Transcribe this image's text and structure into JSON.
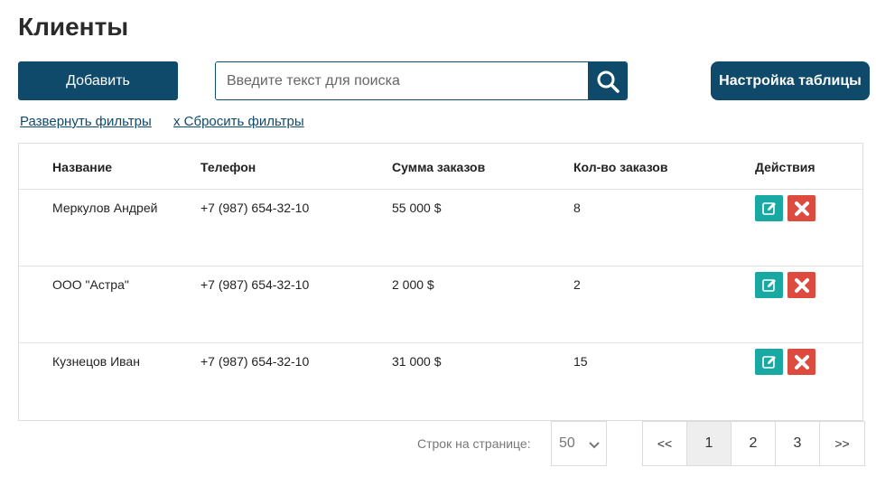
{
  "page": {
    "title": "Клиенты"
  },
  "toolbar": {
    "add_label": "Добавить",
    "search_placeholder": "Введите текст для поиска",
    "settings_label": "Настройка таблицы"
  },
  "filters": {
    "expand_label": "Развернуть фильтры",
    "reset_label": "x Сбросить фильтры"
  },
  "table": {
    "headers": [
      "Название",
      "Телефон",
      "Сумма заказов",
      "Кол-во заказов",
      "Действия"
    ],
    "rows": [
      {
        "name": "Меркулов Андрей",
        "phone": "+7 (987) 654-32-10",
        "sum": "55 000 $",
        "count": "8"
      },
      {
        "name": "ООО \"Астра\"",
        "phone": "+7 (987) 654-32-10",
        "sum": "2 000 $",
        "count": "2"
      },
      {
        "name": "Кузнецов Иван",
        "phone": "+7 (987) 654-32-10",
        "sum": "31 000 $",
        "count": "15"
      }
    ]
  },
  "pagination": {
    "rows_label": "Строк на странице:",
    "rows_per_page": "50",
    "prev": "<<",
    "pages": [
      "1",
      "2",
      "3"
    ],
    "next": ">>",
    "current": "1"
  },
  "colors": {
    "primary": "#0f4a6b",
    "edit": "#1aa8a3",
    "delete": "#dc4b3e"
  },
  "icons": {
    "search": "search-icon",
    "edit": "edit-icon",
    "delete": "close-icon",
    "dropdown": "chevron-down-icon"
  }
}
